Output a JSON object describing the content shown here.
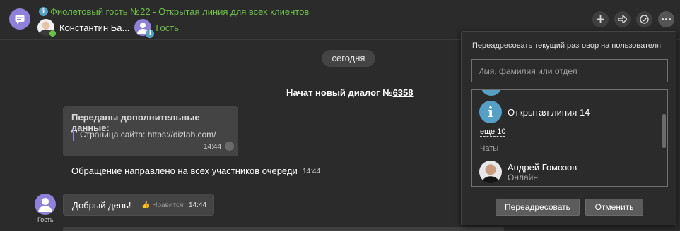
{
  "header": {
    "title": "Фиолетовый гость №22 - Открытая линия для всех клиентов",
    "participant_name": "Константин Ба...",
    "guest_label": "Гость",
    "actions": [
      "+",
      "→",
      "✓",
      "…"
    ]
  },
  "chat": {
    "date_pill": "сегодня",
    "new_dialog_label": "Начат новый диалог №",
    "new_dialog_number": "6358",
    "system_card": {
      "title": "Переданы дополнительные данные:",
      "text": "Страница сайта: https://dizlab.com/",
      "time": "14:44"
    },
    "notice": {
      "text": "Обращение направлено на всех участников очереди",
      "time": "14:44"
    },
    "guest_caption": "Гость",
    "message": {
      "text": "Добрый день!",
      "like_label": "Нравится",
      "time": "14:44"
    }
  },
  "forward_popup": {
    "title": "Переадресовать текущий разговор на пользователя",
    "search_placeholder": "Имя, фамилия или отдел",
    "line_item": "Открытая линия 14",
    "more_link": "еще 10",
    "section_chats": "Чаты",
    "user": {
      "name": "Андрей Гомозов",
      "status": "Онлайн"
    },
    "forward_button": "Переадресовать",
    "cancel_button": "Отменить"
  },
  "colors": {
    "background": "#2b2b2b",
    "accent_green": "#6fc04b",
    "accent_purple": "#8f81d8",
    "info_blue": "#55a0c4"
  }
}
